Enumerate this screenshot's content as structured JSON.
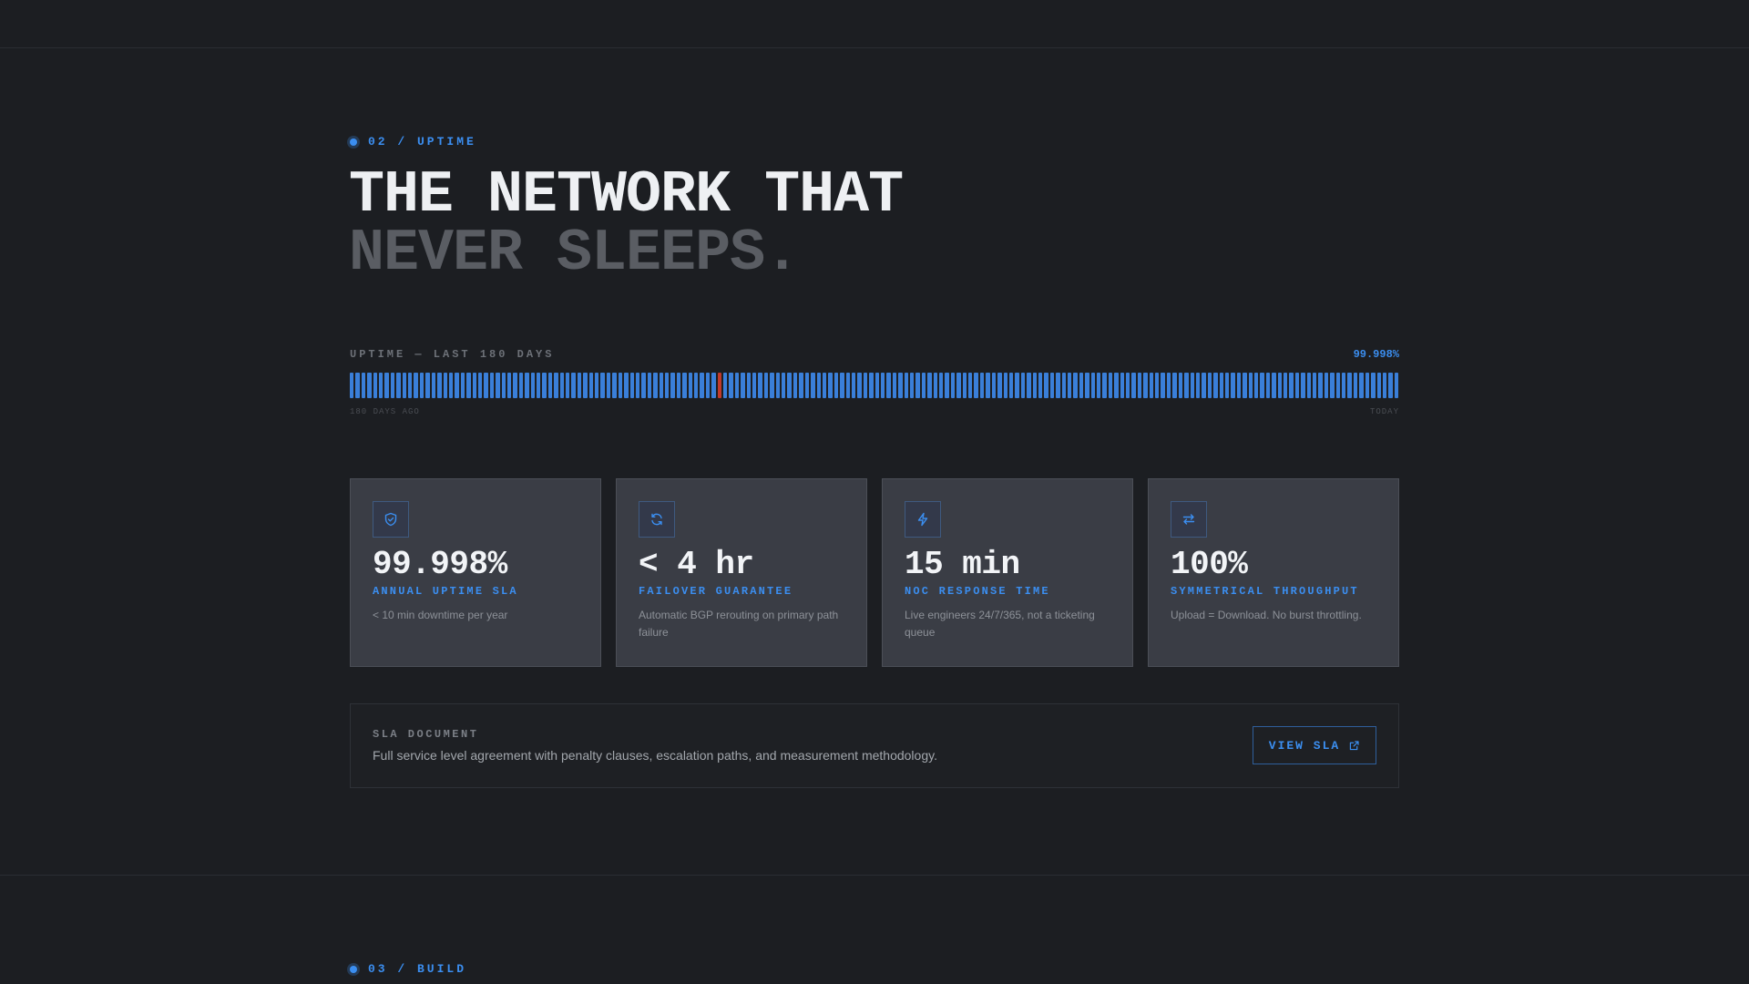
{
  "section": {
    "eyebrow": "02 / UPTIME"
  },
  "headline": {
    "line1": "THE NETWORK THAT",
    "line2": "NEVER SLEEPS."
  },
  "uptime_chart": {
    "label": "UPTIME — LAST 180 DAYS",
    "value": "99.998%",
    "days": 180,
    "incident_day_index": 63,
    "start_label": "180 DAYS AGO",
    "end_label": "TODAY",
    "colors": {
      "up": "#3a7fd9",
      "down": "#c0392b"
    }
  },
  "cards": [
    {
      "icon": "shield-check-icon",
      "value": "99.998%",
      "label": "ANNUAL UPTIME SLA",
      "desc": "< 10 min downtime per year"
    },
    {
      "icon": "refresh-icon",
      "value": "< 4 hr",
      "label": "FAILOVER GUARANTEE",
      "desc": "Automatic BGP rerouting on primary path failure"
    },
    {
      "icon": "lightning-icon",
      "value": "15 min",
      "label": "NOC RESPONSE TIME",
      "desc": "Live engineers 24/7/365, not a ticketing queue"
    },
    {
      "icon": "swap-arrows-icon",
      "value": "100%",
      "label": "SYMMETRICAL THROUGHPUT",
      "desc": "Upload = Download. No burst throttling."
    }
  ],
  "sla": {
    "title": "SLA DOCUMENT",
    "desc": "Full service level agreement with penalty clauses, escalation paths, and measurement methodology.",
    "button_label": "VIEW SLA",
    "button_icon": "external-link-icon"
  },
  "next_section": {
    "eyebrow": "03 / BUILD"
  },
  "colors": {
    "accent": "#3b8ef0",
    "background": "#1c1e22",
    "card": "#3a3d45"
  }
}
